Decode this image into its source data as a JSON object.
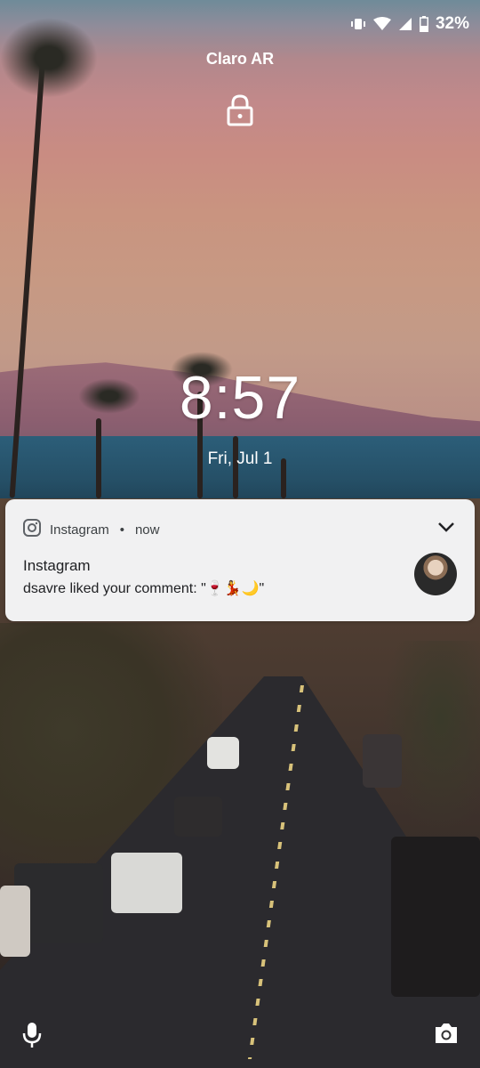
{
  "status_bar": {
    "battery_percent": "32%",
    "icons": [
      "vibrate-icon",
      "wifi-icon",
      "signal-icon",
      "battery-icon"
    ]
  },
  "carrier": "Claro AR",
  "lock_icon": "lock-icon",
  "clock": {
    "time": "8:57",
    "date": "Fri, Jul 1"
  },
  "notification": {
    "app_icon": "instagram-icon",
    "app_name": "Instagram",
    "separator": "•",
    "time": "now",
    "title": "Instagram",
    "text_prefix": "dsavre liked your comment: \"",
    "text_emojis": "🍷💃🌙",
    "text_suffix": "\"",
    "expand_icon": "chevron-down-icon"
  },
  "shortcuts": {
    "left": "microphone-icon",
    "right": "camera-icon"
  }
}
